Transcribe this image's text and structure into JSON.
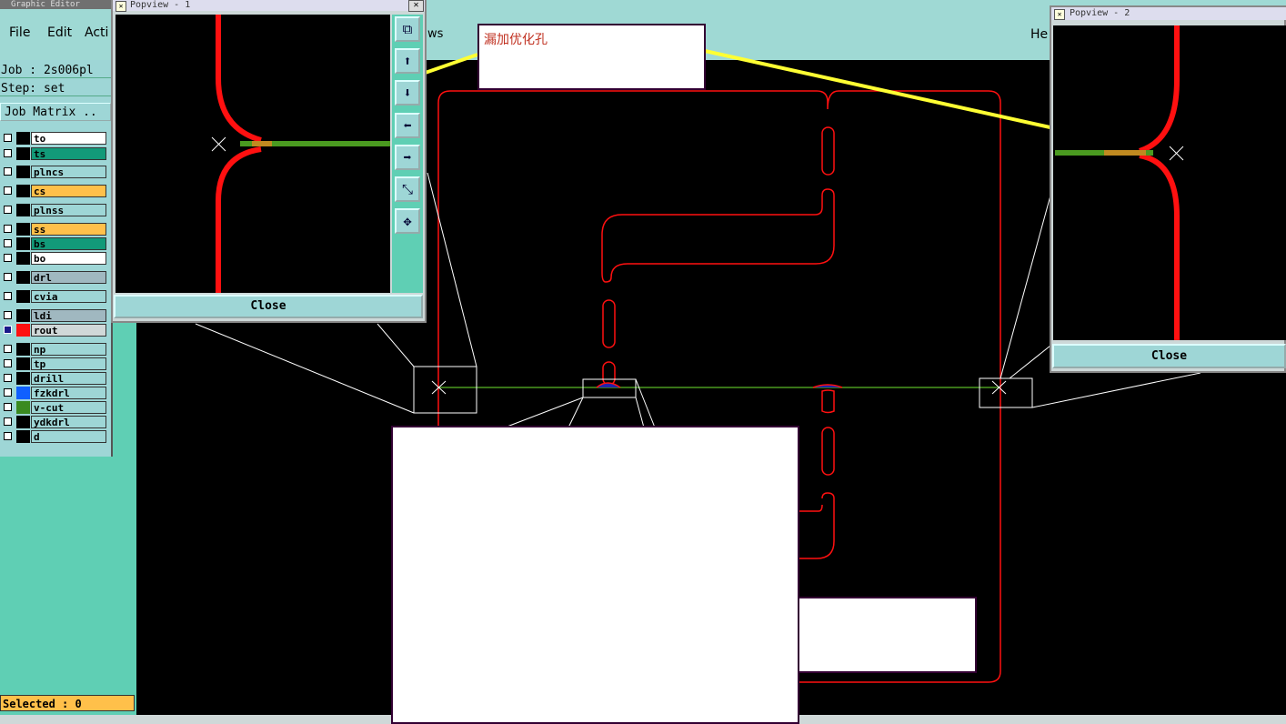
{
  "main_window": {
    "title": "Graphic Editor"
  },
  "menu": {
    "file": "File",
    "edit": "Edit",
    "actions": "Acti",
    "views": "ws",
    "help": "He"
  },
  "job": {
    "job_label": "Job : 2s006pl",
    "step_label": "Step: set",
    "matrix_button": "Job Matrix .."
  },
  "layers": [
    {
      "name": "to",
      "color": "#ffffff"
    },
    {
      "name": "ts",
      "color": "#129a79"
    },
    {
      "name": "plncs",
      "color": "#9ed6d6"
    },
    {
      "name": "cs",
      "color": "#ffc04a"
    },
    {
      "name": "plnss",
      "color": "#9ed6d6"
    },
    {
      "name": "ss",
      "color": "#ffc04a"
    },
    {
      "name": "bs",
      "color": "#129a79"
    },
    {
      "name": "bo",
      "color": "#ffffff"
    },
    {
      "name": "drl",
      "color": "#a0b8c0"
    },
    {
      "name": "cvia",
      "color": "#9ed6d6"
    },
    {
      "name": "ldi",
      "color": "#a0b8c0"
    },
    {
      "name": "rout",
      "color": "#d0d8d8"
    },
    {
      "name": "np",
      "color": "#9ed6d6"
    },
    {
      "name": "tp",
      "color": "#9ed6d6"
    },
    {
      "name": "drill",
      "color": "#9ed6d6"
    },
    {
      "name": "fzkdrl",
      "color": "#9ed6d6"
    },
    {
      "name": "v-cut",
      "color": "#9ed6d6"
    },
    {
      "name": "ydkdrl",
      "color": "#9ed6d6"
    },
    {
      "name": "d",
      "color": "#9ed6d6"
    }
  ],
  "selected": {
    "label": "Selected : 0"
  },
  "popview1": {
    "title": "Popview - 1",
    "close": "Close"
  },
  "popview2": {
    "title": "Popview - 2",
    "close": "Close"
  },
  "annotation": {
    "text": "漏加优化孔"
  },
  "colors": {
    "panel": "#9ed6d6",
    "route": "#ff0000",
    "vcut": "#4a9a20",
    "arrow": "#ffff33"
  }
}
